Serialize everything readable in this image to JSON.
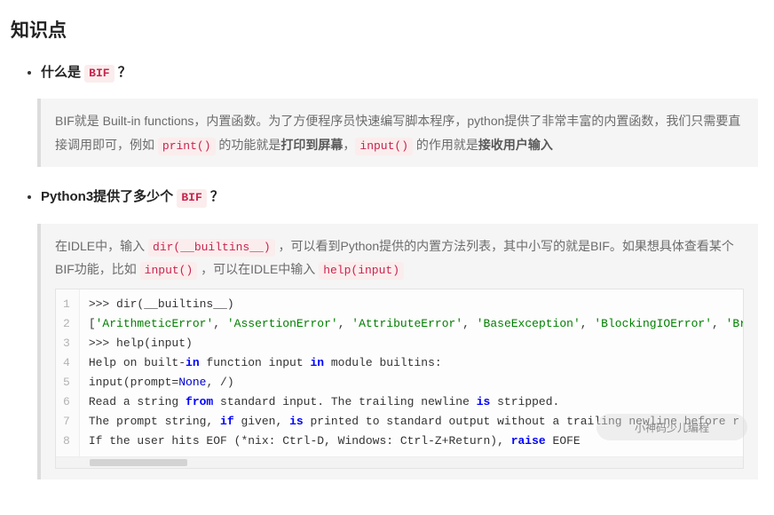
{
  "heading": "知识点",
  "item1": {
    "title_pre": "什么是 ",
    "title_code": "BIF",
    "title_post": " ？",
    "quote_p1a": "BIF就是 Built-in functions，内置函数。为了方便程序员快速编写脚本程序，python提供了非常丰富的内置函数，我们只需要直接调用即可，例如 ",
    "quote_code1": "print()",
    "quote_p1b": " 的功能就是",
    "quote_strong1": "打印到屏幕",
    "quote_p1c": "，",
    "quote_code2": "input()",
    "quote_p1d": " 的作用就是",
    "quote_strong2": "接收用户输入"
  },
  "item2": {
    "title_pre": "Python3提供了多少个 ",
    "title_code": "BIF",
    "title_post": " ？",
    "quote_p1a": "在IDLE中，输入 ",
    "quote_code1": "dir(__builtins__)",
    "quote_p1b": " ，可以看到Python提供的内置方法列表，其中小写的就是BIF。如果想具体查看某个BIF功能，比如 ",
    "quote_code2": "input()",
    "quote_p1c": " ，可以在IDLE中输入 ",
    "quote_code3": "help(input)"
  },
  "code": {
    "l1_a": ">>> dir(__builtins__)",
    "l2_b1": "[",
    "l2_s1": "'ArithmeticError'",
    "l2_c": ", ",
    "l2_s2": "'AssertionError'",
    "l2_s3": "'AttributeError'",
    "l2_s4": "'BaseException'",
    "l2_s5": "'BlockingIOError'",
    "l2_s6": "'BrokenPipeEr",
    "l3_a": ">>> help(input)",
    "l4_a": "Help on built-",
    "l4_kw1": "in",
    "l4_b": " function input ",
    "l4_kw2": "in",
    "l4_c": " module builtins:",
    "l5_a": "input(prompt=",
    "l5_none": "None",
    "l5_b": ", /)",
    "l6_a": "Read a string ",
    "l6_kw1": "from",
    "l6_b": " standard input.  The trailing newline ",
    "l6_kw2": "is",
    "l6_c": " stripped.",
    "l7_a": "The prompt string, ",
    "l7_kw1": "if",
    "l7_b": " given, ",
    "l7_kw2": "is",
    "l7_c": " printed to standard output without a trailing newline before r",
    "l8_a": "If the user hits EOF (*nix: Ctrl-D, Windows: Ctrl-Z+Return), ",
    "l8_kw1": "raise",
    "l8_b": " EOFE"
  },
  "line_numbers": [
    "1",
    "2",
    "3",
    "4",
    "5",
    "6",
    "7",
    "8"
  ],
  "watermark": "小神码少儿编程"
}
